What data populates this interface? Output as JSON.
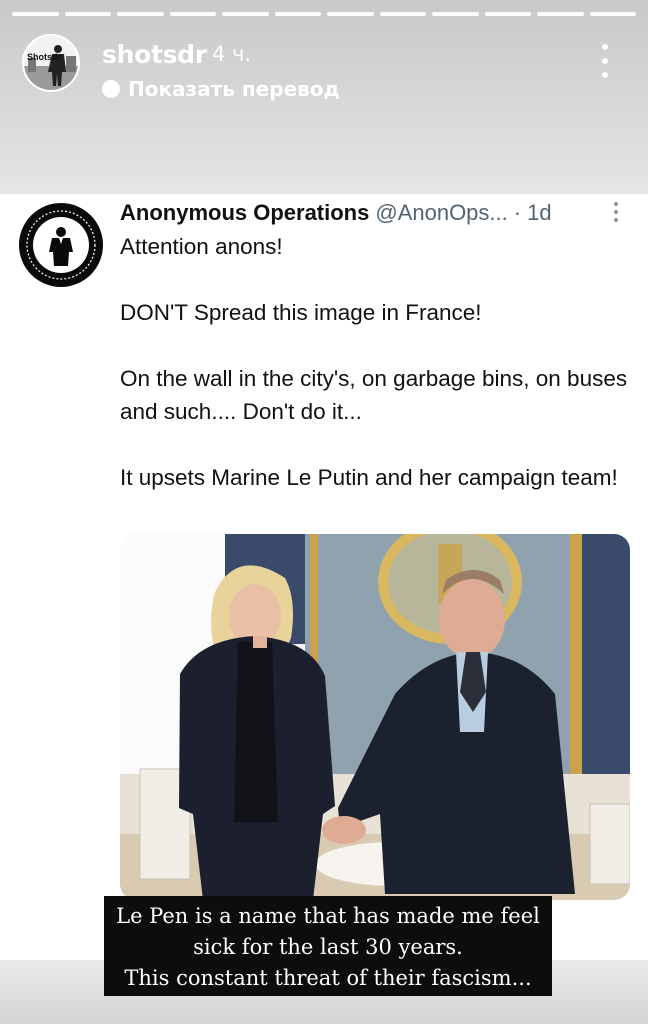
{
  "story": {
    "username": "shotsdr",
    "avatar_text": "Shotsdr",
    "time_ago": "4 ч.",
    "translate_label": "Показать перевод",
    "progress_segments": 12
  },
  "tweet": {
    "display_name": "Anonymous Operations",
    "handle": "@AnonOps...",
    "separator": "·",
    "time": "1d",
    "paragraphs": [
      "Attention anons!",
      "DON'T Spread this image in France!",
      "On the wall in the city's, on garbage bins, on buses and such.... Don't do it...",
      "It upsets Marine Le Putin and her campaign team!"
    ]
  },
  "caption": {
    "lines": [
      "Le Pen is a name that has made me feel",
      "sick for the last 30 years.",
      "This constant threat of their fascism..."
    ]
  },
  "colors": {
    "caption_bg": "#0d0d0d",
    "handle_gray": "#536471"
  }
}
